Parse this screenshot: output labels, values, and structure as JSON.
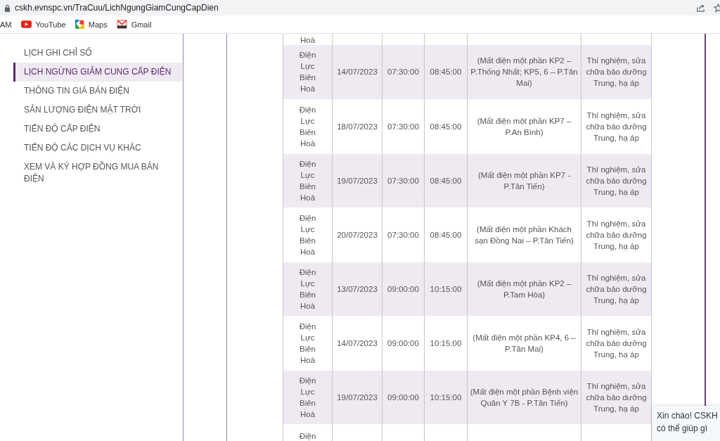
{
  "browser": {
    "url": "cskh.evnspc.vn/TraCuu/LichNgungGiamCungCapDien"
  },
  "bookmarks": [
    {
      "label": "AM",
      "kind": "plain"
    },
    {
      "label": "YouTube",
      "kind": "youtube"
    },
    {
      "label": "Maps",
      "kind": "maps"
    },
    {
      "label": "Gmail",
      "kind": "gmail"
    }
  ],
  "sidebar": {
    "items": [
      {
        "label": "LỊCH GHI CHỈ SỐ",
        "selected": false
      },
      {
        "label": "LỊCH NGỪNG GIẢM CUNG CẤP ĐIỆN",
        "selected": true
      },
      {
        "label": "THÔNG TIN GIÁ BÁN ĐIỆN",
        "selected": false
      },
      {
        "label": "SẢN LƯỢNG ĐIỆN MẶT TRỜI",
        "selected": false
      },
      {
        "label": "TIẾN ĐỘ CẤP ĐIỆN",
        "selected": false
      },
      {
        "label": "TIẾN ĐỘ CÁC DỊCH VỤ KHÁC",
        "selected": false
      },
      {
        "label": "XEM VÀ KÝ HỢP ĐỒNG MUA BÁN ĐIỆN",
        "selected": false
      }
    ]
  },
  "table": {
    "rows": [
      {
        "unit": "Hoà",
        "kind": "cut_top"
      },
      {
        "unit": "Điện Lực Biên Hoà",
        "date": "14/07/2023",
        "start": "07:30:00",
        "end": "08:45:00",
        "description": "(Mất điện một phần KP2 – P.Thống Nhất; KP5, 6 – P.Tân Mai)",
        "reason": "Thí nghiệm, sửa chữa bảo dưỡng Trung, hạ áp"
      },
      {
        "unit": "Điện Lực Biên Hoà",
        "date": "18/07/2023",
        "start": "07:30:00",
        "end": "08:45:00",
        "description": "(Mất điện một phần KP7 – P.An Bình)",
        "reason": "Thí nghiệm, sửa chữa bảo dưỡng Trung, hạ áp"
      },
      {
        "unit": "Điện Lực Biên Hoà",
        "date": "19/07/2023",
        "start": "07:30:00",
        "end": "08:45:00",
        "description": "(Mất điện một phần KP7 - P.Tân Tiến)",
        "reason": "Thí nghiệm, sửa chữa bảo dưỡng Trung, hạ áp"
      },
      {
        "unit": "Điện Lực Biên Hoà",
        "date": "20/07/2023",
        "start": "07:30:00",
        "end": "08:45:00",
        "description": "(Mất điện một phần Khách sạn Đồng Nai – P.Tân Tiến)",
        "reason": "Thí nghiệm, sửa chữa bảo dưỡng Trung, hạ áp"
      },
      {
        "unit": "Điện Lực Biên Hoà",
        "date": "13/07/2023",
        "start": "09:00:00",
        "end": "10:15:00",
        "description": "(Mất điện một phần KP2 – P.Tam Hòa)",
        "reason": "Thí nghiệm, sửa chữa bảo dưỡng Trung, hạ áp"
      },
      {
        "unit": "Điện Lực Biên Hoà",
        "date": "14/07/2023",
        "start": "09:00:00",
        "end": "10:15:00",
        "description": "(Mất điện một phần KP4, 6 – P.Tân Mai)",
        "reason": "Thí nghiệm, sửa chữa bảo dưỡng Trung, hạ áp"
      },
      {
        "unit": "Điện Lực Biên Hoà",
        "date": "19/07/2023",
        "start": "09:00:00",
        "end": "10:15:00",
        "description": "(Mất điện một phần Bệnh viện Quân Y 7B - P.Tân Tiến)",
        "reason": "Thí nghiệm, sửa chữa bảo dưỡng Trung, hạ áp"
      },
      {
        "unit": "Điện",
        "kind": "cut_bottom"
      }
    ]
  },
  "chat": {
    "lines": [
      "Xin chào! CSKH",
      "có thể giúp gì"
    ]
  }
}
